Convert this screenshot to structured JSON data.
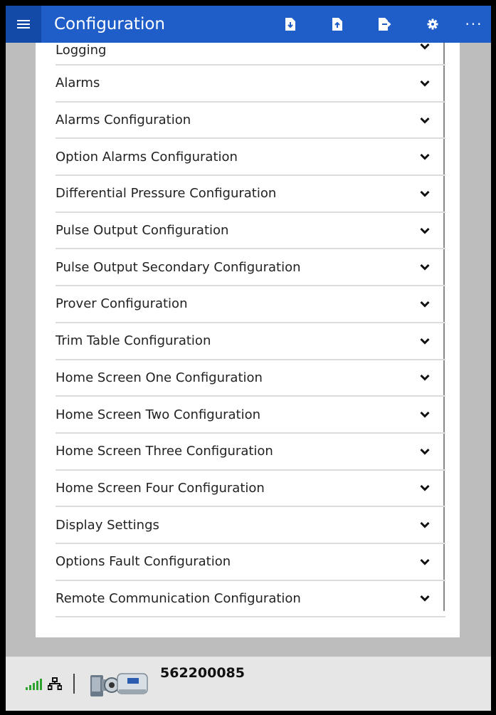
{
  "window": {
    "title": "Configuration"
  },
  "toolbar": {
    "icons": [
      "menu-icon",
      "file-download-icon",
      "file-upload-icon",
      "file-export-icon",
      "gear-icon",
      "more-icon"
    ],
    "more_label": "···"
  },
  "sections": [
    {
      "label": "Logging"
    },
    {
      "label": "Alarms"
    },
    {
      "label": "Alarms Configuration"
    },
    {
      "label": "Option Alarms Configuration"
    },
    {
      "label": "Differential Pressure Configuration"
    },
    {
      "label": "Pulse Output Configuration"
    },
    {
      "label": "Pulse Output Secondary Configuration"
    },
    {
      "label": "Prover Configuration"
    },
    {
      "label": "Trim Table Configuration"
    },
    {
      "label": "Home Screen One Configuration"
    },
    {
      "label": "Home Screen Two Configuration"
    },
    {
      "label": "Home Screen Three Configuration"
    },
    {
      "label": "Home Screen Four Configuration"
    },
    {
      "label": "Display Settings"
    },
    {
      "label": "Options Fault Configuration"
    },
    {
      "label": "Remote Communication Configuration"
    }
  ],
  "status": {
    "device_serial": "562200085",
    "signal_color": "#2da12d"
  },
  "colors": {
    "accent": "#1f5ec8",
    "accent_dark": "#134aa8"
  }
}
